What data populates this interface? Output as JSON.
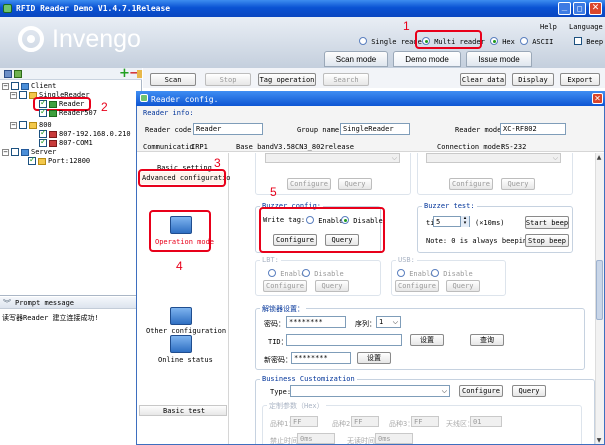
{
  "app": {
    "title": "RFID Reader Demo V1.4.7.1Release",
    "logo": "Invengo",
    "help": "Help",
    "language": "Language"
  },
  "topbar": {
    "single_reader": "Single reader",
    "multi_reader": "Multi reader",
    "hex": "Hex",
    "ascii": "ASCII",
    "beep": "Beep"
  },
  "modes": [
    "Scan mode",
    "Demo mode",
    "Issue mode"
  ],
  "toolbar": {
    "scan": "Scan",
    "stop": "Stop",
    "tag_operation": "Tag operation",
    "search": "Search",
    "clear_data": "Clear data",
    "display": "Display",
    "export": "Export"
  },
  "tree": {
    "client": "Client",
    "single_reader": "SingleReader",
    "reader": "Reader",
    "reader507": "Reader507",
    "group800": "800",
    "ip": "807-192.168.0.210",
    "com": "807-COM1",
    "server": "Server",
    "port": "Port:12800"
  },
  "prompt": {
    "title": "Prompt message",
    "message": "读写器Reader 建立连接成功!"
  },
  "dialog": {
    "title": "Reader config.",
    "info_legend": "Reader info:",
    "reader_code_label": "Reader code:",
    "reader_code": "Reader",
    "group_name_label": "Group name:",
    "group_name": "SingleReader",
    "reader_model_label": "Reader model:",
    "reader_model": "XC-RF802",
    "communicatio_label": "Communicatio",
    "communicatio_value": "IRP1",
    "base_band": "Base bandV3.58CN3_802release",
    "connection_mode_label": "Connection mode:",
    "connection_mode": "RS-232"
  },
  "leftnav": {
    "basic_setting": "Basic setting",
    "advanced_configuration": "Advanced configuration",
    "operation_mode": "Operation mode",
    "other_configuration": "Other configuration",
    "online_status": "Online status",
    "basic_test": "Basic test"
  },
  "content": {
    "configure": "Configure",
    "query": "Query",
    "buzzer_config": "Buzzer config:",
    "write_tag": "Write tag:",
    "enable": "Enable",
    "disable": "Disable",
    "buzzer_test": "Buzzer test:",
    "time_label": "time",
    "time_value": "5",
    "time_unit": "(×10ms)",
    "start_beep": "Start beep",
    "stop_beep": "Stop beep",
    "note": "Note: 0 is always beeping.",
    "lbt": "LBT:",
    "usb": "USB:",
    "decoder_settings": "解锁器设置：",
    "password_label": "密码：",
    "password_value": "********",
    "serial_label": "序列：",
    "serial_value": "1",
    "set": "设置",
    "tid_label": "TID：",
    "query_cn": "查询",
    "new_password_label": "新密码：",
    "new_password_value": "********",
    "business_legend": "Business Customization",
    "type_label": "Type:",
    "fixed_params": "定制参数（Hex）",
    "product_1": "品种1：",
    "product_1_value": "FF",
    "product_2": "品种2：",
    "product_2_value": "FF",
    "product_3": "品种3：",
    "product_3_value": "FF",
    "antenna_zone": "天线区：",
    "antenna_zone_value": "01",
    "forbidden_time": "禁止时间：",
    "forbidden_time_value": "0ms",
    "no_read_time": "无读时间：",
    "no_read_time_value": "0ms"
  },
  "annotations": [
    "1",
    "2",
    "3",
    "4",
    "5"
  ],
  "colors": {
    "titlebar": "#0a52d3",
    "accent_red": "#e8001a",
    "legend_blue": "#003399"
  }
}
